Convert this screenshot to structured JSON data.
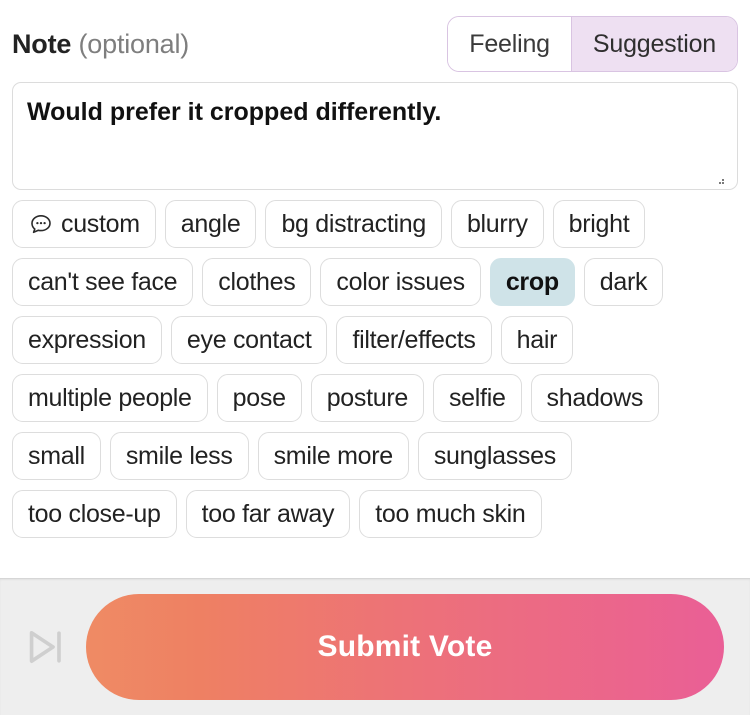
{
  "note_section": {
    "label_strong": "Note",
    "label_muted": "(optional)",
    "toggle": {
      "options": [
        {
          "label": "Feeling",
          "active": false
        },
        {
          "label": "Suggestion",
          "active": true
        }
      ]
    },
    "textarea": {
      "value": "Would prefer it cropped differently.",
      "placeholder": ""
    }
  },
  "tags": [
    {
      "label": "custom",
      "icon": "chat-bubble-icon",
      "selected": false
    },
    {
      "label": "angle",
      "selected": false
    },
    {
      "label": "bg distracting",
      "selected": false
    },
    {
      "label": "blurry",
      "selected": false
    },
    {
      "label": "bright",
      "selected": false
    },
    {
      "label": "can't see face",
      "selected": false
    },
    {
      "label": "clothes",
      "selected": false
    },
    {
      "label": "color issues",
      "selected": false
    },
    {
      "label": "crop",
      "selected": true
    },
    {
      "label": "dark",
      "selected": false
    },
    {
      "label": "expression",
      "selected": false
    },
    {
      "label": "eye contact",
      "selected": false
    },
    {
      "label": "filter/effects",
      "selected": false
    },
    {
      "label": "hair",
      "selected": false
    },
    {
      "label": "multiple people",
      "selected": false
    },
    {
      "label": "pose",
      "selected": false
    },
    {
      "label": "posture",
      "selected": false
    },
    {
      "label": "selfie",
      "selected": false
    },
    {
      "label": "shadows",
      "selected": false
    },
    {
      "label": "small",
      "selected": false
    },
    {
      "label": "smile less",
      "selected": false
    },
    {
      "label": "smile more",
      "selected": false
    },
    {
      "label": "sunglasses",
      "selected": false
    },
    {
      "label": "too close-up",
      "selected": false
    },
    {
      "label": "too far away",
      "selected": false
    },
    {
      "label": "too much skin",
      "selected": false
    }
  ],
  "footer": {
    "skip_icon": "skip-next-icon",
    "submit_label": "Submit Vote"
  },
  "colors": {
    "toggle_active_bg": "#eee0f2",
    "toggle_border": "#d9c4e2",
    "tag_selected_bg": "#cfe3e8",
    "tag_border": "#dddddd",
    "submit_gradient_start": "#ef8b64",
    "submit_gradient_end": "#ea5f96",
    "footer_bg": "#eeeeee"
  }
}
